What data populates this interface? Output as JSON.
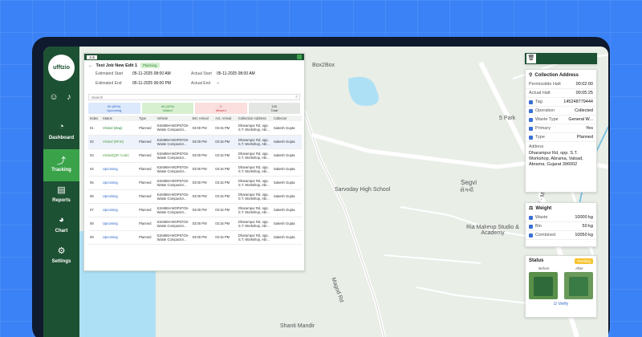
{
  "brand": "ufftzio",
  "nav": [
    {
      "label": "Dashboard",
      "icon": "gauge-icon",
      "glyph": "◔"
    },
    {
      "label": "Tracking",
      "icon": "route-icon",
      "glyph": "⤴"
    },
    {
      "label": "Reports",
      "icon": "document-icon",
      "glyph": "▤"
    },
    {
      "label": "Chart",
      "icon": "pie-chart-icon",
      "glyph": "◕"
    },
    {
      "label": "Settings",
      "icon": "gear-icon",
      "glyph": "⚙"
    }
  ],
  "map_labels": [
    "Box2Box",
    "5 Park",
    "Sarvoday High School",
    "Segvi",
    "સેગવી",
    "Ria Makeup Studio & Academy",
    "Shanti Mandir",
    "Segvi - Magod Rd",
    "Magod Rd"
  ],
  "job": {
    "tab": "Job",
    "title": "Test Job New Edit 1",
    "status": "Planning",
    "est_start_label": "Estimated Start",
    "est_start": "05-11-2025 08:00 AM",
    "est_end_label": "Estimated End",
    "est_end": "05-11-2025 06:00 PM",
    "act_start_label": "Actual Start",
    "act_start": "05-11-2025 08:00 AM",
    "act_end_label": "Actual End",
    "act_end": "--",
    "search_placeholder": "Search",
    "stats": [
      {
        "line1": "60 (60%)",
        "line2": "Upcoming",
        "bg": "#dce8fb",
        "fg": "#2a64c7"
      },
      {
        "line1": "40 (40%)",
        "line2": "Visited",
        "bg": "#d7f0d0",
        "fg": "#2f8a3a"
      },
      {
        "line1": "0",
        "line2": "Missed",
        "bg": "#fbdede",
        "fg": "#c73a3a"
      },
      {
        "line1": "100",
        "line2": "Total",
        "bg": "#e4e6e4",
        "fg": "#333"
      }
    ],
    "columns": [
      "Index",
      "Status",
      "Type",
      "Vehicle",
      "Est. Arrival",
      "Act. Arrival",
      "Collection Address",
      "Collector"
    ],
    "rows": [
      {
        "index": "01",
        "status": "Visited (Map)",
        "type": "Planned",
        "vehicle": "619486H-MOP67G5-Waste Compactor...",
        "est": "03:00 PM",
        "act": "03:15 PM",
        "addr": "Dharampur Rd, opp. S.T. Workshop, Abr...",
        "collector": "Sakesh Gupta"
      },
      {
        "index": "02",
        "status": "Visited (RFID)",
        "type": "Planned",
        "vehicle": "619486H-MOP67G5-Waste Compactor...",
        "est": "03:00 PM",
        "act": "03:15 PM",
        "addr": "Dharampur Rd, opp. S.T. Workshop, Abr...",
        "collector": "Sakesh Gupta"
      },
      {
        "index": "03",
        "status": "Visited(QR Code)",
        "type": "Planned",
        "vehicle": "619486H-MOP67G5-Waste Compactor...",
        "est": "03:00 PM",
        "act": "03:15 PM",
        "addr": "Dharampur Rd, opp. S.T. Workshop, Abr...",
        "collector": "Sakesh Gupta"
      },
      {
        "index": "04",
        "status": "Upcoming",
        "type": "Planned",
        "vehicle": "619486H-MOP67G5-Waste Compactor...",
        "est": "03:00 PM",
        "act": "03:15 PM",
        "addr": "Dharampur Rd, opp. S.T. Workshop, Abr...",
        "collector": "Sakesh Gupta"
      },
      {
        "index": "05",
        "status": "Upcoming",
        "type": "Planned",
        "vehicle": "619486H-MOP67G5-Waste Compactor...",
        "est": "03:00 PM",
        "act": "03:15 PM",
        "addr": "Dharampur Rd, opp. S.T. Workshop, Abr...",
        "collector": "Sakesh Gupta"
      },
      {
        "index": "06",
        "status": "Upcoming",
        "type": "Planned",
        "vehicle": "619486H-MOP67G5-Waste Compactor...",
        "est": "03:00 PM",
        "act": "03:15 PM",
        "addr": "Dharampur Rd, opp. S.T. Workshop, Abr...",
        "collector": "Sakesh Gupta"
      },
      {
        "index": "07",
        "status": "Upcoming",
        "type": "Planned",
        "vehicle": "619486H-MOP67G5-Waste Compactor...",
        "est": "03:00 PM",
        "act": "03:15 PM",
        "addr": "Dharampur Rd, opp. S.T. Workshop, Abr...",
        "collector": "Sakesh Gupta"
      },
      {
        "index": "08",
        "status": "Upcoming",
        "type": "Planned",
        "vehicle": "619486H-MOP67G5-Waste Compactor...",
        "est": "03:00 PM",
        "act": "03:15 PM",
        "addr": "Dharampur Rd, opp. S.T. Workshop, Abr...",
        "collector": "Sakesh Gupta"
      },
      {
        "index": "09",
        "status": "Upcoming",
        "type": "Planned",
        "vehicle": "619486H-MOP67G5-Waste Compactor...",
        "est": "03:00 PM",
        "act": "03:15 PM",
        "addr": "Dharampur Rd, opp. S.T. Workshop, Abr...",
        "collector": "Sakesh Gupta"
      }
    ]
  },
  "collection": {
    "title": "Collection Address",
    "permissible_halt_label": "Permissible Halt",
    "permissible_halt": "00:02:00",
    "actual_halt_label": "Actual Halt",
    "actual_halt": "00:05:25",
    "tag_label": "Tag",
    "tag": "145248779444",
    "operation_label": "Operation",
    "operation": "Collected",
    "waste_type_label": "Waste Type",
    "waste_type": "General W...",
    "primary_label": "Primary",
    "primary": "Yes",
    "type_label": "Type",
    "type": "Planned",
    "address_label": "Address",
    "address": "Dharampur Rd, opp. S.T. Workshop, Abrama, Valsad, Abrama, Gujarat 396002"
  },
  "weight": {
    "title": "Weight",
    "waste_label": "Waste",
    "waste": "10000 kg",
    "bin_label": "Bin",
    "bin": "50 kg",
    "combined_label": "Combined",
    "combined": "10050 kg"
  },
  "status_card": {
    "title": "Status",
    "badge": "Pending",
    "before": "Before",
    "after": "After",
    "verify": "Verify"
  }
}
